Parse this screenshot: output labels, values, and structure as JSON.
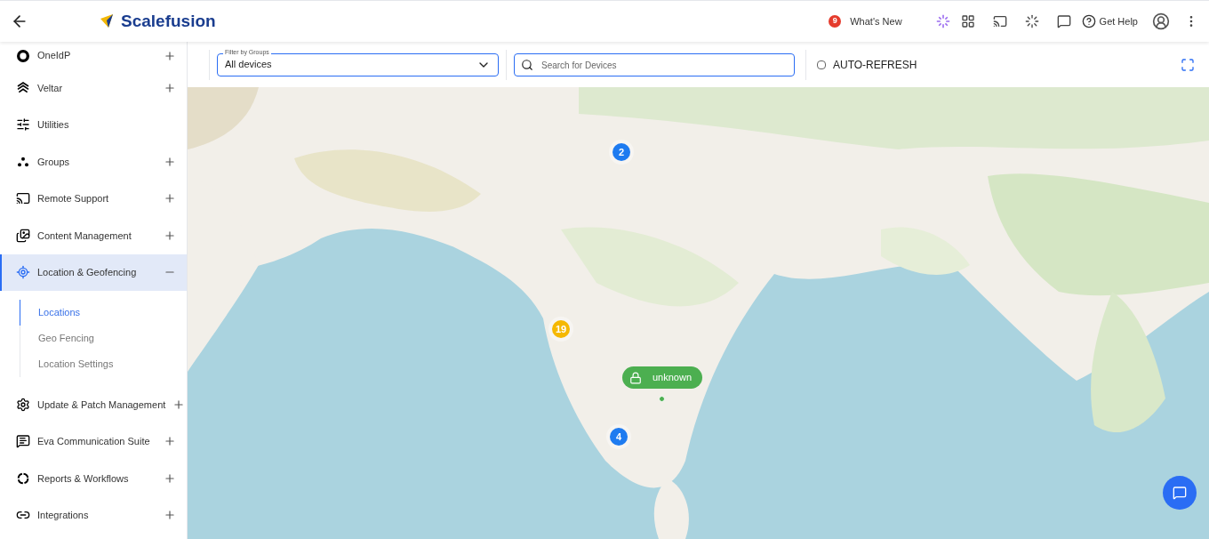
{
  "header": {
    "brand": "Scalefusion",
    "whats_new": {
      "badge": "9",
      "label": "What's New"
    },
    "help": "Get Help"
  },
  "sidebar": {
    "items": [
      {
        "label": "OneIdP",
        "expanded": false,
        "selected": false
      },
      {
        "label": "Veltar",
        "expanded": false,
        "selected": false
      },
      {
        "label": "Utilities",
        "selected": false
      },
      {
        "label": "Groups",
        "expanded": false,
        "selected": false
      },
      {
        "label": "Remote Support",
        "expanded": false,
        "selected": false
      },
      {
        "label": "Content Management",
        "expanded": false,
        "selected": false
      },
      {
        "label": "Location & Geofencing",
        "expanded": true,
        "selected": true,
        "children": [
          {
            "label": "Locations",
            "selected": true
          },
          {
            "label": "Geo Fencing",
            "selected": false
          },
          {
            "label": "Location Settings",
            "selected": false
          }
        ]
      },
      {
        "label": "Update & Patch Management",
        "expanded": false,
        "selected": false
      },
      {
        "label": "Eva Communication Suite",
        "expanded": false,
        "selected": false
      },
      {
        "label": "Reports & Workflows",
        "expanded": false,
        "selected": false
      },
      {
        "label": "Integrations",
        "expanded": false,
        "selected": false
      }
    ]
  },
  "filter": {
    "label": "Filter by Groups",
    "value": "All devices"
  },
  "search": {
    "placeholder": "Search for Devices"
  },
  "auto_refresh": {
    "label": "AUTO-REFRESH",
    "checked": false
  },
  "map": {
    "markers": [
      {
        "kind": "cluster",
        "count": "2",
        "color": "#1e7bf0"
      },
      {
        "kind": "cluster",
        "count": "19",
        "color": "#f5b800"
      },
      {
        "kind": "cluster",
        "count": "4",
        "color": "#1e7bf0"
      },
      {
        "kind": "device",
        "label": "unknown",
        "color": "#4caf50"
      }
    ]
  }
}
